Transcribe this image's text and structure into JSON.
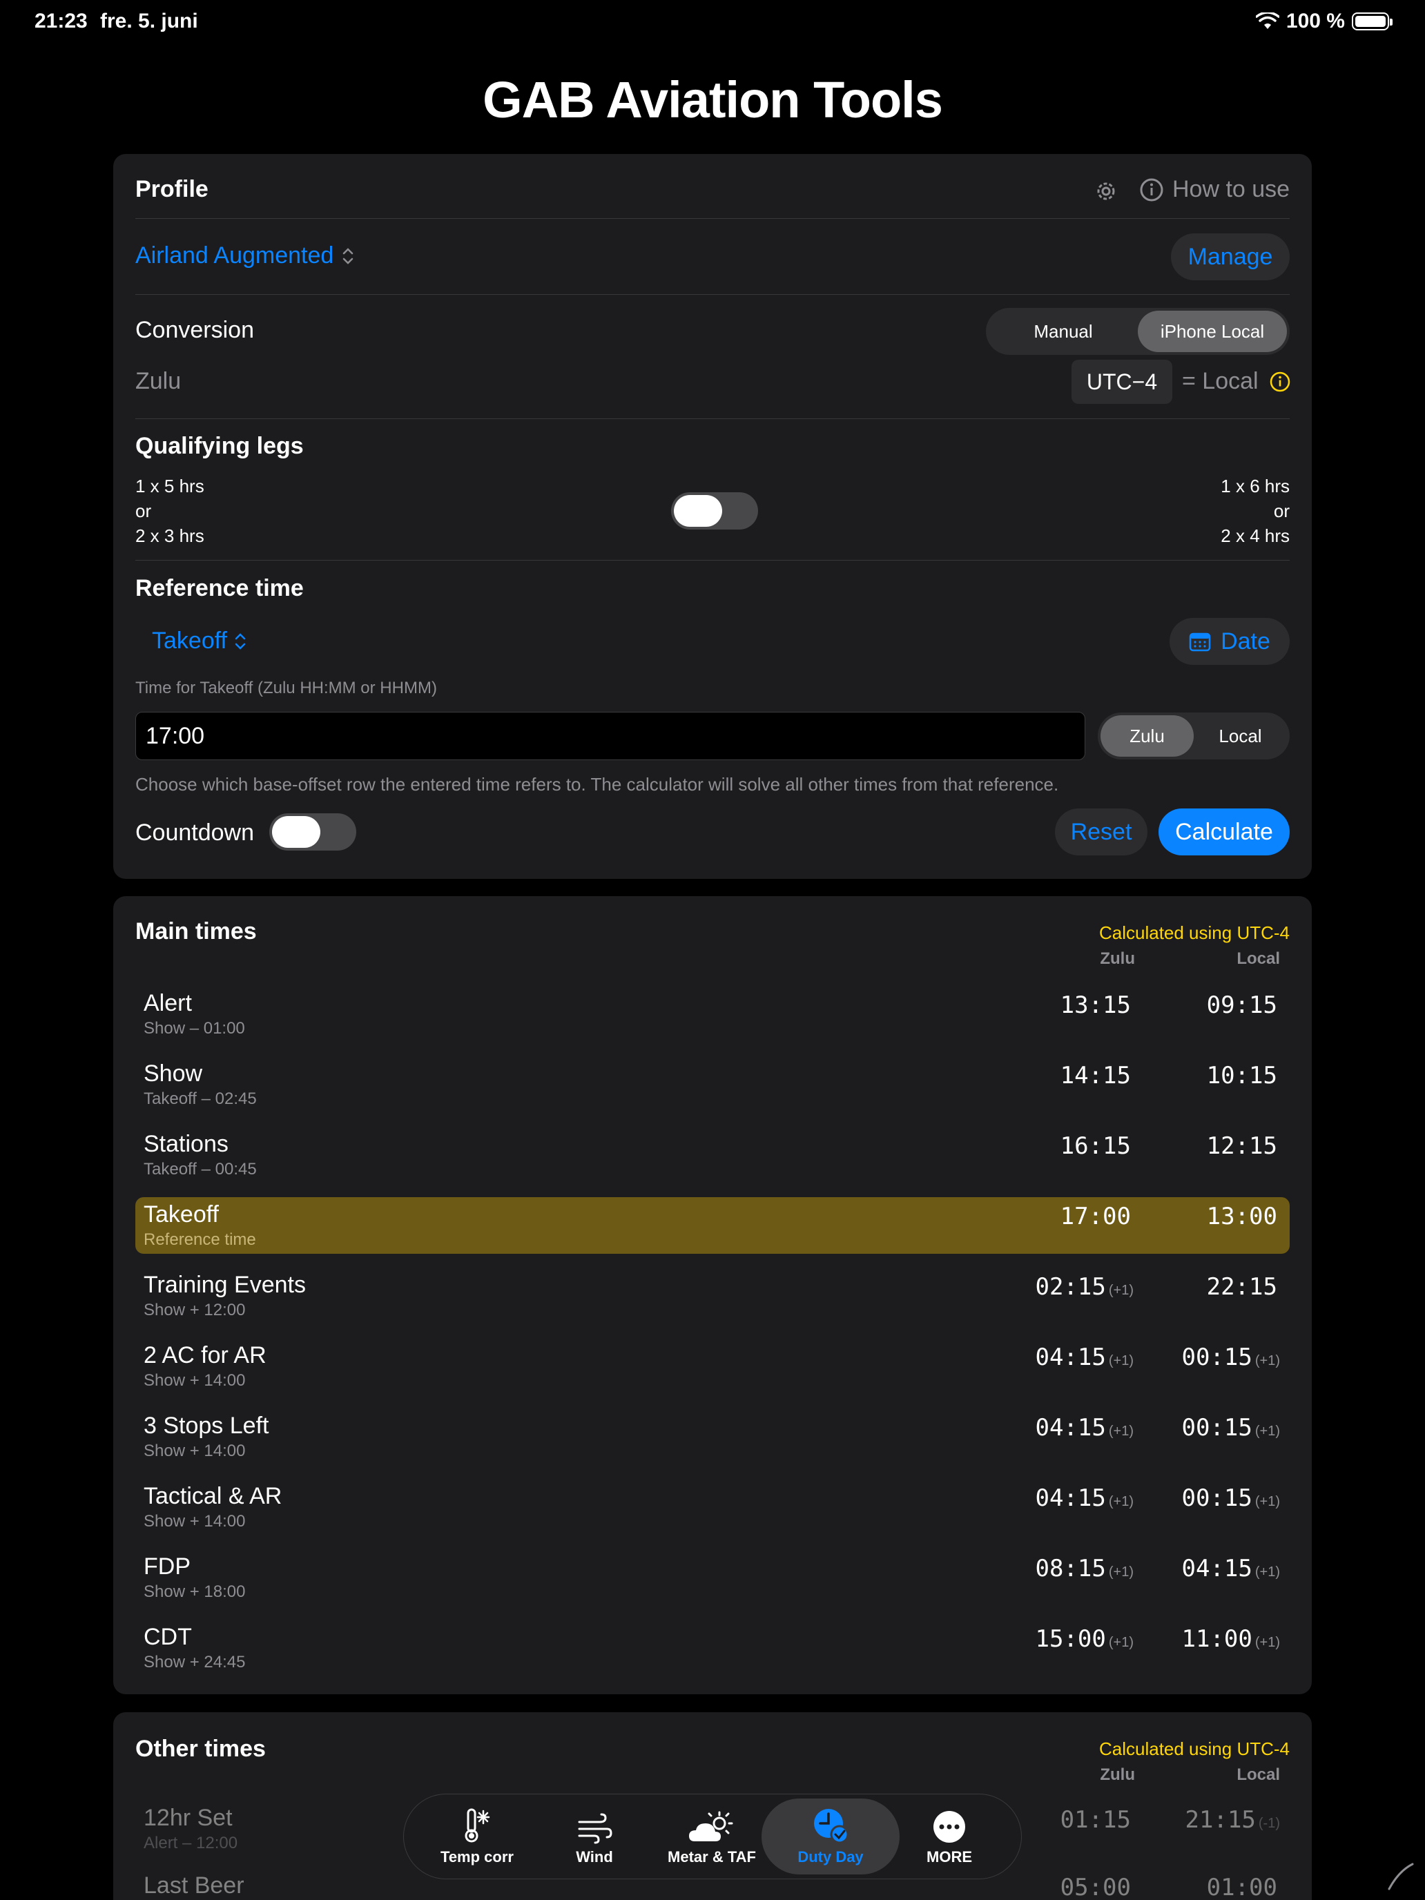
{
  "status": {
    "time": "21:23",
    "date": "fre. 5. juni",
    "battery": "100 %"
  },
  "app_title": "GAB Aviation Tools",
  "profile": {
    "header": "Profile",
    "how_to_use": "How to use",
    "selected_profile": "Airland Augmented",
    "manage_label": "Manage",
    "conversion_label": "Conversion",
    "conversion_options": [
      "Manual",
      "iPhone Local"
    ],
    "conversion_selected": "iPhone Local",
    "zulu_label": "Zulu",
    "utc_offset": "UTC−4",
    "equals_local": "= Local"
  },
  "qualifying_legs": {
    "header": "Qualifying legs",
    "left": [
      "1 x 5 hrs",
      "or",
      "2 x 3 hrs"
    ],
    "right": [
      "1 x 6 hrs",
      "or",
      "2 x 4 hrs"
    ]
  },
  "reference_time": {
    "header": "Reference time",
    "selected": "Takeoff",
    "date_label": "Date",
    "input_label": "Time for Takeoff (Zulu HH:MM or HHMM)",
    "input_value": "17:00",
    "zone_options": [
      "Zulu",
      "Local"
    ],
    "zone_selected": "Zulu",
    "hint": "Choose which base-offset row the entered time refers to. The calculator will solve all other times from that reference.",
    "countdown_label": "Countdown",
    "countdown_on": false,
    "reset_label": "Reset",
    "calculate_label": "Calculate"
  },
  "main_times": {
    "header": "Main times",
    "calculated_using": "Calculated using UTC-4",
    "col_zulu": "Zulu",
    "col_local": "Local",
    "rows": [
      {
        "name": "Alert",
        "sub": "Show – 01:00",
        "zulu": "13:15",
        "zulu_plus": "",
        "local": "09:15",
        "local_plus": ""
      },
      {
        "name": "Show",
        "sub": "Takeoff – 02:45",
        "zulu": "14:15",
        "zulu_plus": "",
        "local": "10:15",
        "local_plus": ""
      },
      {
        "name": "Stations",
        "sub": "Takeoff – 00:45",
        "zulu": "16:15",
        "zulu_plus": "",
        "local": "12:15",
        "local_plus": ""
      },
      {
        "name": "Takeoff",
        "sub": "Reference time",
        "zulu": "17:00",
        "zulu_plus": "",
        "local": "13:00",
        "local_plus": ""
      },
      {
        "name": "Training Events",
        "sub": "Show + 12:00",
        "zulu": "02:15",
        "zulu_plus": "(+1)",
        "local": "22:15",
        "local_plus": ""
      },
      {
        "name": "2 AC for AR",
        "sub": "Show + 14:00",
        "zulu": "04:15",
        "zulu_plus": "(+1)",
        "local": "00:15",
        "local_plus": "(+1)"
      },
      {
        "name": "3 Stops Left",
        "sub": "Show + 14:00",
        "zulu": "04:15",
        "zulu_plus": "(+1)",
        "local": "00:15",
        "local_plus": "(+1)"
      },
      {
        "name": "Tactical & AR",
        "sub": "Show + 14:00",
        "zulu": "04:15",
        "zulu_plus": "(+1)",
        "local": "00:15",
        "local_plus": "(+1)"
      },
      {
        "name": "FDP",
        "sub": "Show + 18:00",
        "zulu": "08:15",
        "zulu_plus": "(+1)",
        "local": "04:15",
        "local_plus": "(+1)"
      },
      {
        "name": "CDT",
        "sub": "Show + 24:45",
        "zulu": "15:00",
        "zulu_plus": "(+1)",
        "local": "11:00",
        "local_plus": "(+1)"
      }
    ]
  },
  "other_times": {
    "header": "Other times",
    "calculated_using": "Calculated using UTC-4",
    "col_zulu": "Zulu",
    "col_local": "Local",
    "rows": [
      {
        "name": "12hr Set",
        "sub": "Alert – 12:00",
        "zulu": "01:15",
        "zulu_plus": "",
        "local": "21:15",
        "local_plus": "(-1)"
      },
      {
        "name": "Last Beer",
        "sub": "",
        "zulu": "05:00",
        "zulu_plus": "",
        "local": "01:00",
        "local_plus": ""
      }
    ]
  },
  "tabs": [
    {
      "label": "Temp corr",
      "icon": "thermometer-snow-icon"
    },
    {
      "label": "Wind",
      "icon": "wind-icon"
    },
    {
      "label": "Metar & TAF",
      "icon": "cloud-sun-icon"
    },
    {
      "label": "Duty Day",
      "icon": "clock-check-icon"
    },
    {
      "label": "MORE",
      "icon": "ellipsis-circle-icon"
    }
  ],
  "selected_tab": "Duty Day",
  "colors": {
    "accent": "#0a84ff",
    "highlight": "#6d5a14",
    "calc_using": "#ffd60a",
    "card": "#1c1c1e"
  }
}
